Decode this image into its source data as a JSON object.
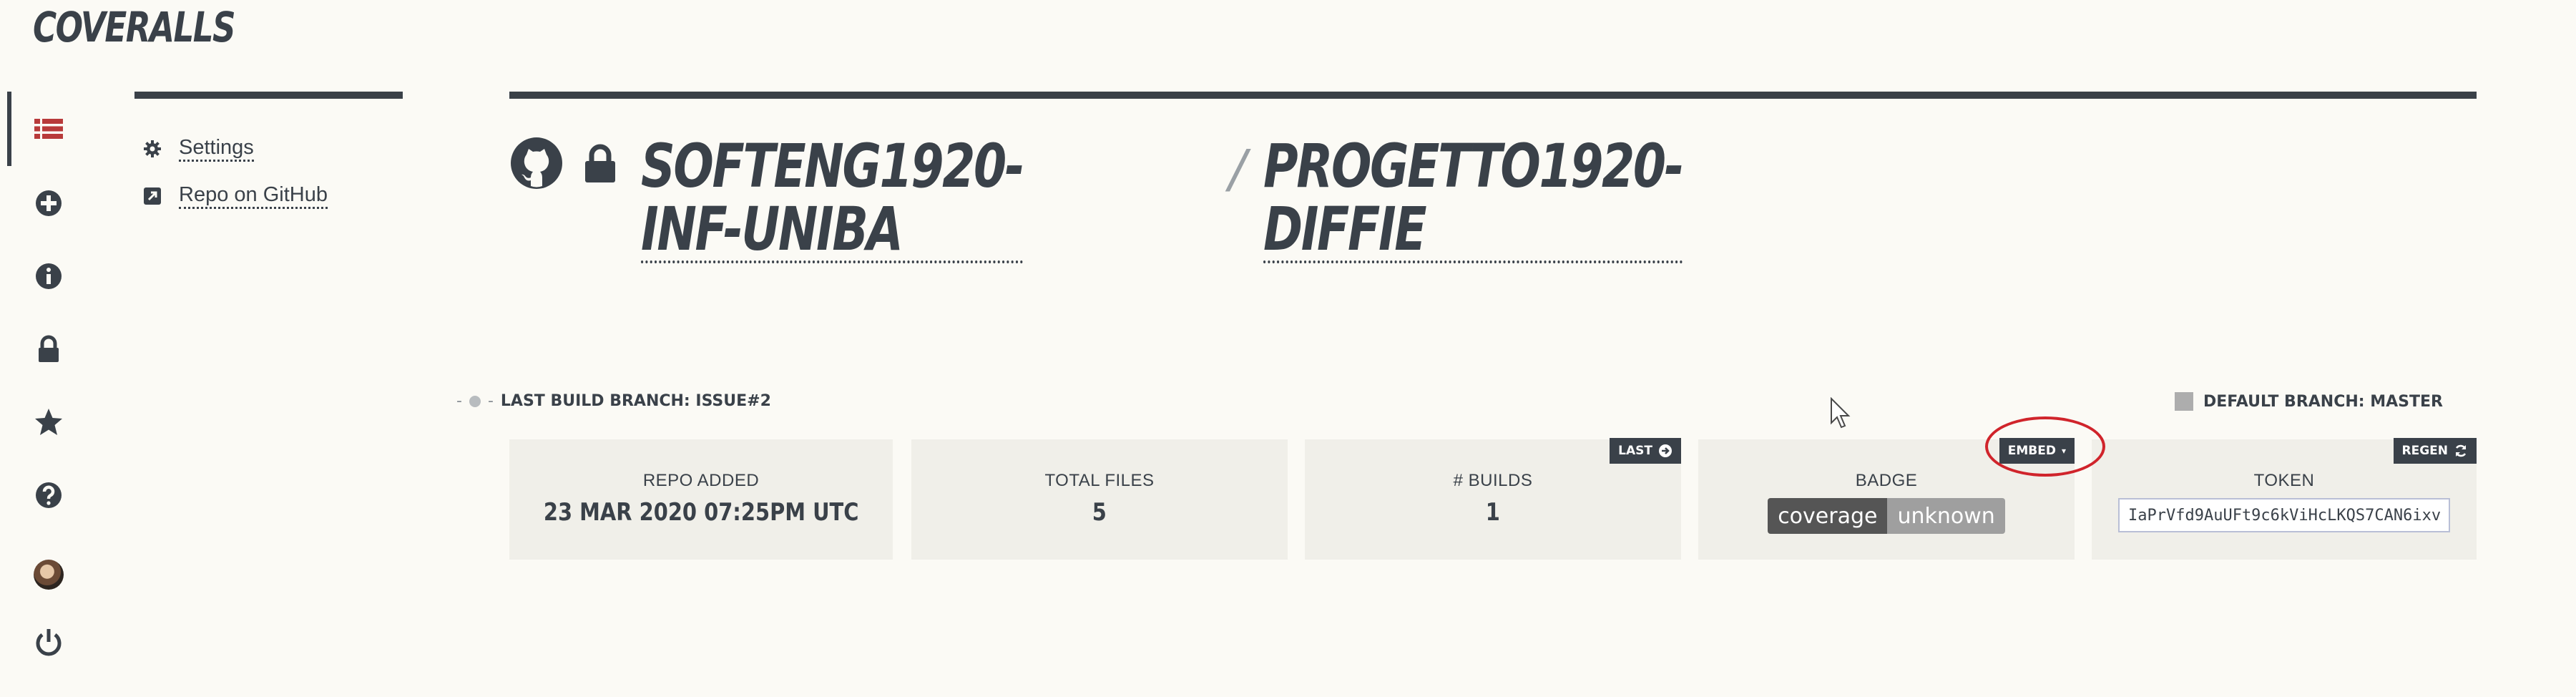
{
  "brand": {
    "name": "COVERALLS"
  },
  "rail": {
    "icons": [
      "list-icon",
      "plus-circle-icon",
      "info-icon",
      "lock-icon",
      "star-icon",
      "question-icon",
      "avatar",
      "power-icon"
    ]
  },
  "subnav": {
    "items": [
      {
        "label": "Settings",
        "icon": "gear-icon"
      },
      {
        "label": "Repo on GitHub",
        "icon": "external-link-icon"
      }
    ]
  },
  "header": {
    "org": "SOFTENG1920-INF-UNIBA",
    "separator": "/",
    "repo": "PROGETTO1920-DIFFIE"
  },
  "branches": {
    "last_build": "LAST BUILD BRANCH: ISSUE#2",
    "default": "DEFAULT BRANCH: MASTER"
  },
  "stats": {
    "repo_added": {
      "label": "REPO ADDED",
      "value": "23 MAR 2020 07:25PM UTC"
    },
    "total_files": {
      "label": "TOTAL FILES",
      "value": "5"
    },
    "builds": {
      "label": "# BUILDS",
      "value": "1",
      "button": "LAST"
    },
    "badge": {
      "label": "BADGE",
      "button": "EMBED",
      "left": "coverage",
      "right": "unknown"
    },
    "token": {
      "label": "TOKEN",
      "button": "REGEN",
      "value": "IaPrVfd9AuUFt9c6kViHcLKQS7CAN6ixv"
    }
  },
  "colors": {
    "background": "#fbfaf5",
    "ink": "#3a4149",
    "accent_red": "#b83a3a",
    "highlight_ring": "#d0242b",
    "card": "#f0efe9"
  }
}
